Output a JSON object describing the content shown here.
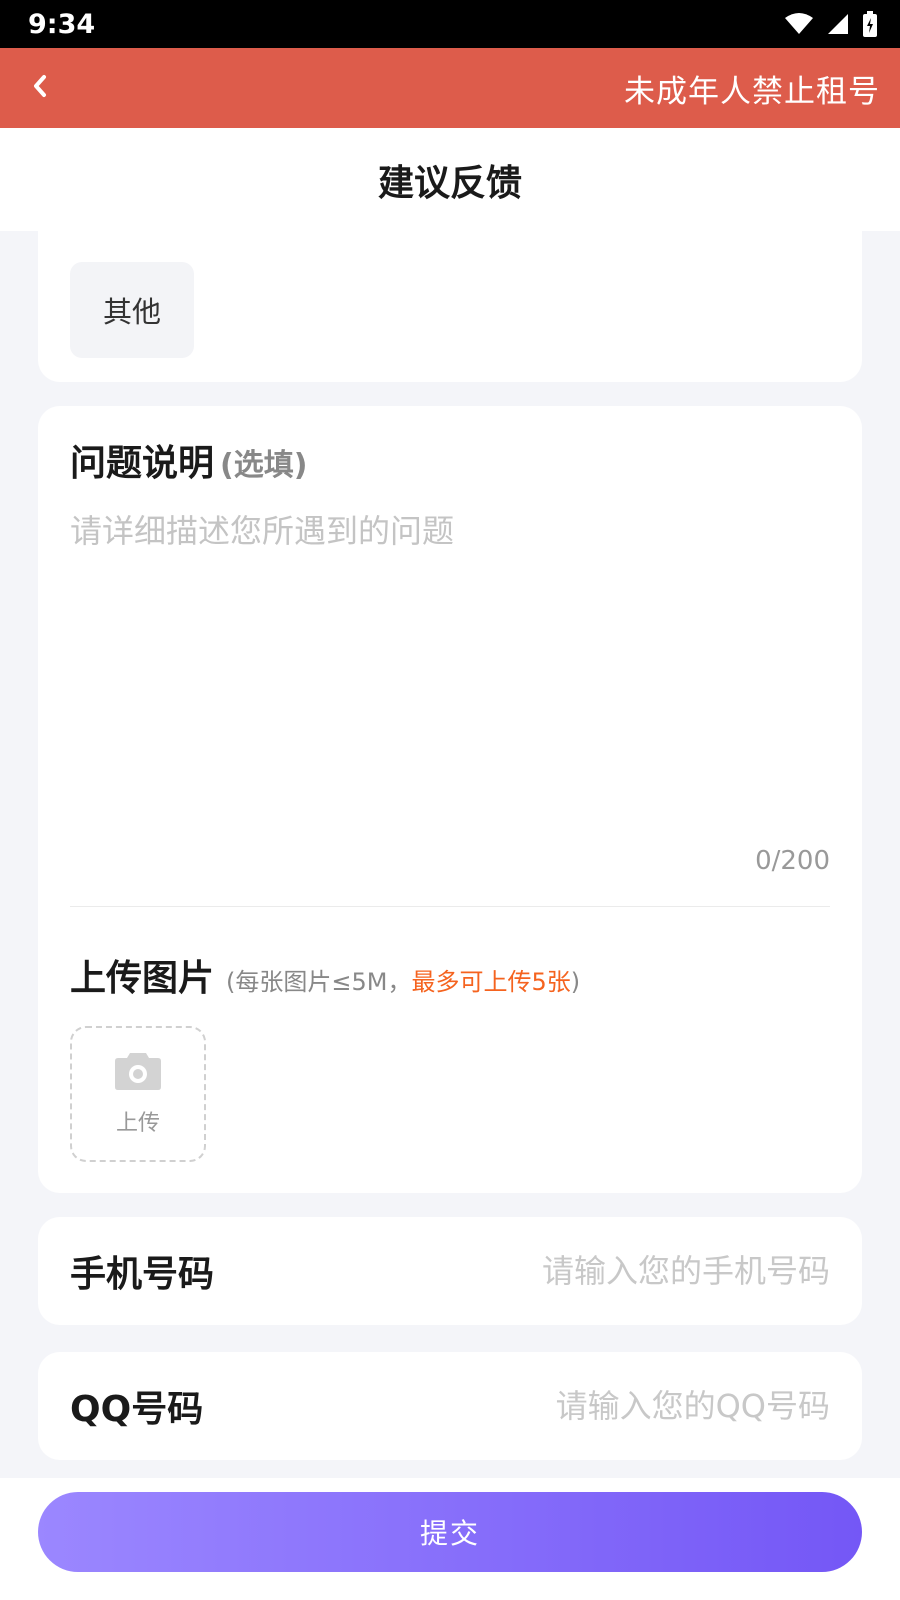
{
  "status_bar": {
    "time": "9:34",
    "icons": [
      "wifi-icon",
      "signal-icon",
      "battery-icon"
    ]
  },
  "top_banner": {
    "back_icon": "chevron-left-icon",
    "text": "未成年人禁止租号",
    "background": "#dd5c4b"
  },
  "header": {
    "title": "建议反馈"
  },
  "category": {
    "selected_option": "其他"
  },
  "description": {
    "title": "问题说明",
    "optional_hint": "(选填)",
    "placeholder": "请详细描述您所遇到的问题",
    "counter": "0/200"
  },
  "upload": {
    "title": "上传图片",
    "note_open": "(",
    "note_size": "每张图片≤5M，",
    "note_limit": "最多可上传5张",
    "note_close": ")",
    "button_label": "上传",
    "icon": "camera-icon",
    "highlight_color": "#f5631f"
  },
  "phone": {
    "label": "手机号码",
    "placeholder": "请输入您的手机号码"
  },
  "qq": {
    "label": "QQ号码",
    "placeholder": "请输入您的QQ号码"
  },
  "submit": {
    "label": "提交",
    "gradient_start": "#9b87ff",
    "gradient_end": "#7457f6"
  }
}
